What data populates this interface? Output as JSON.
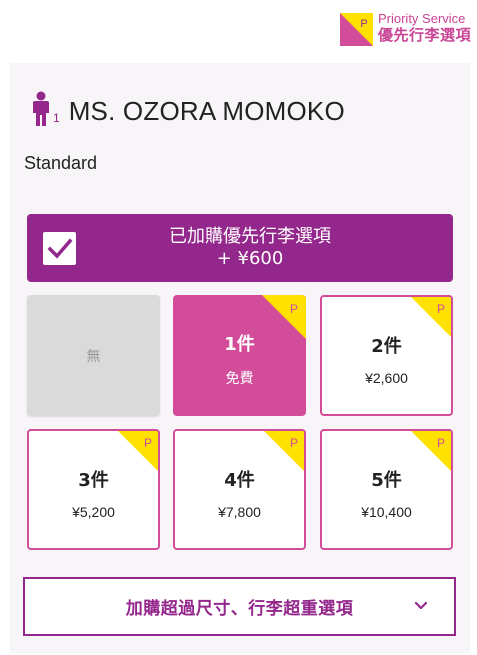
{
  "header": {
    "badge_en": "Priority Service",
    "badge_zh": "優先行李選項",
    "badge_icon_letter": "P"
  },
  "passenger": {
    "index": "1",
    "name": "MS. OZORA MOMOKO",
    "fare_type": "Standard"
  },
  "selection": {
    "checked": true,
    "line1": "已加購優先行李選項",
    "line2": "+ ¥600"
  },
  "options": [
    {
      "count": "",
      "price": "",
      "none_label": "無",
      "state": "none"
    },
    {
      "count": "1件",
      "price": "免費",
      "state": "active",
      "corner": "P"
    },
    {
      "count": "2件",
      "price": "¥2,600",
      "state": "normal",
      "corner": "P"
    },
    {
      "count": "3件",
      "price": "¥5,200",
      "state": "normal",
      "corner": "P"
    },
    {
      "count": "4件",
      "price": "¥7,800",
      "state": "normal",
      "corner": "P"
    },
    {
      "count": "5件",
      "price": "¥10,400",
      "state": "normal",
      "corner": "P"
    }
  ],
  "expand": {
    "label": "加購超過尺寸、行李超重選項",
    "icon": "chevron-down-icon"
  },
  "colors": {
    "brand_purple": "#93278c",
    "brand_pink": "#d34c99",
    "corner_yellow": "#ffe100"
  }
}
